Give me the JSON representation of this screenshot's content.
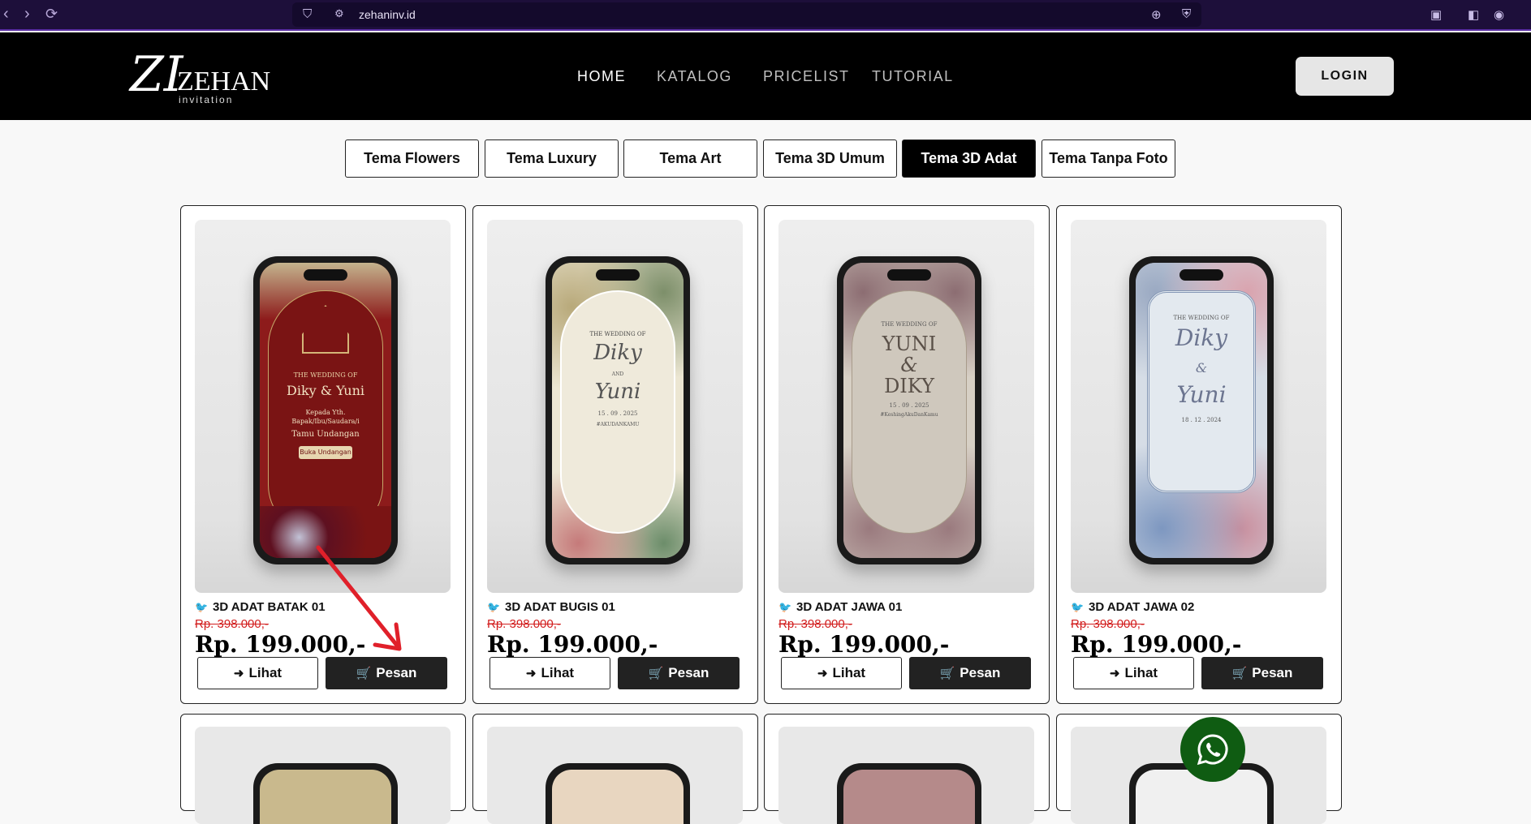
{
  "browser": {
    "url": "zehaninv.id",
    "back_icon": "chevron-left-icon",
    "forward_icon": "chevron-right-icon",
    "reload_icon": "reload-icon"
  },
  "header": {
    "logo_mark": "ZI",
    "logo_word": "ZEHAN",
    "logo_sub": "invitation",
    "nav": [
      "HOME",
      "KATALOG",
      "PRICELIST",
      "TUTORIAL"
    ],
    "active_nav": "HOME",
    "login_label": "LOGIN"
  },
  "tabs": {
    "items": [
      "Tema Flowers",
      "Tema Luxury",
      "Tema Art",
      "Tema 3D Umum",
      "Tema 3D Adat",
      "Tema Tanpa Foto"
    ],
    "active": "Tema 3D Adat"
  },
  "products": [
    {
      "title": "3D ADAT BATAK 01",
      "old_price": "Rp. 398.000,-",
      "price": "Rp. 199.000,-",
      "view_label": "Lihat",
      "order_label": "Pesan",
      "screen_lines": [
        "THE WEDDING OF",
        "Diky & Yuni",
        "Kepada Yth.",
        "Bapak/Ibu/Saudara/i",
        "Tamu Undangan",
        "Buka Undangan"
      ]
    },
    {
      "title": "3D ADAT BUGIS 01",
      "old_price": "Rp. 398.000,-",
      "price": "Rp. 199.000,-",
      "view_label": "Lihat",
      "order_label": "Pesan",
      "screen_lines": [
        "THE WEDDING OF",
        "Diky",
        "AND",
        "Yuni",
        "15 . 09 . 2025",
        "#AKUDANKAMU"
      ]
    },
    {
      "title": "3D ADAT JAWA 01",
      "old_price": "Rp. 398.000,-",
      "price": "Rp. 199.000,-",
      "view_label": "Lihat",
      "order_label": "Pesan",
      "screen_lines": [
        "THE WEDDING OF",
        "YUNI",
        "&",
        "DIKY",
        "15 . 09 . 2025",
        "#KeshingAkuDanKamu"
      ]
    },
    {
      "title": "3D ADAT JAWA 02",
      "old_price": "Rp. 398.000,-",
      "price": "Rp. 199.000,-",
      "view_label": "Lihat",
      "order_label": "Pesan",
      "screen_lines": [
        "THE WEDDING OF",
        "Diky",
        "&",
        "Yuni",
        "18 . 12 . 2024"
      ]
    }
  ],
  "whatsapp_icon": "whatsapp-icon"
}
